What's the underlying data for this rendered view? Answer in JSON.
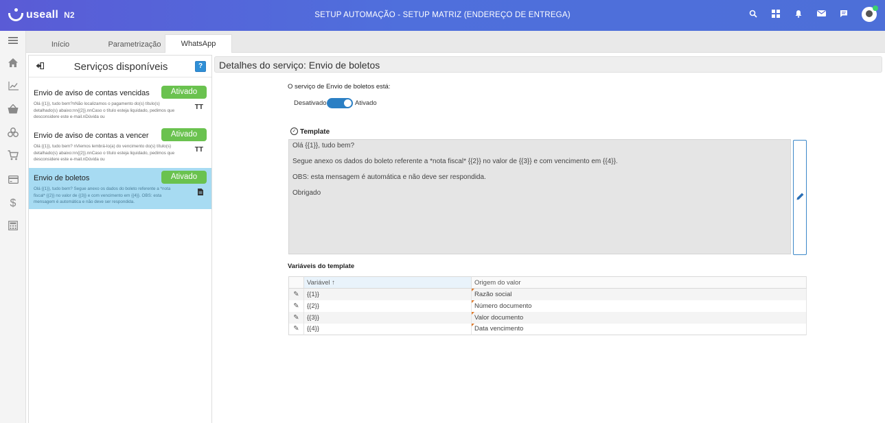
{
  "topbar": {
    "logo_text": "useall",
    "logo_sub": "N2",
    "app_title": "SETUP AUTOMAÇÃO - SETUP MATRIZ (ENDEREÇO DE ENTREGA)",
    "icons": [
      "search-icon",
      "grid-icon",
      "bell-icon",
      "mail-icon",
      "chat-icon",
      "avatar"
    ]
  },
  "rail": {
    "items": [
      "menu-icon",
      "home-icon",
      "chart-icon",
      "basket-icon",
      "boxes-icon",
      "cart-icon",
      "card-icon",
      "dollar-icon",
      "calculator-icon"
    ]
  },
  "tabs": [
    {
      "label": "Início"
    },
    {
      "label": "Parametrização"
    },
    {
      "label": "WhatsApp"
    }
  ],
  "services": {
    "title": "Serviços disponíveis",
    "help": "?",
    "items": [
      {
        "name": "Envio de aviso de contas vencidas",
        "badge": "Ativado",
        "desc": "Olá {{1}}, tudo bem?nNão localizamos o pagamento do(s) título(s) detalhado(s) abaixo:nn{{2}}.nnCaso o título esteja liquidado, pedimos que desconsidere este e-mail.nDúvida ou",
        "icon": "TT"
      },
      {
        "name": "Envio de aviso de contas a vencer",
        "badge": "Ativado",
        "desc": "Olá {{1}}, tudo bem? nViemos lembrá-lo(a) do vencimento do(s) título(s) detalhado(s) abaixo:nn{{2}}.nnCaso o título esteja liquidado, pedimos que desconsidere este e-mail.nDúvida ou",
        "icon": "TT"
      },
      {
        "name": "Envio de boletos",
        "badge": "Ativado",
        "desc": "Olá {{1}}, tudo bem? Segue anexo os dados do boleto referente a *nota fiscal* {{2}} no valor de {{3}} e com vencimento em {{4}}. OBS: esta mensagem é automática e não deve ser respondida.",
        "icon": "▮"
      }
    ]
  },
  "details": {
    "title": "Detalhes do serviço: Envio de boletos",
    "status_label": "O serviço de Envio de boletos está:",
    "toggle_off": "Desativado",
    "toggle_on": "Ativado",
    "template_label": "Template",
    "template_lines": [
      "Olá {{1}}, tudo bem?",
      "Segue anexo os dados do boleto referente a *nota fiscal* {{2}} no valor de {{3}} e com vencimento em {{4}}.",
      "OBS: esta mensagem é automática e não deve ser respondida.",
      "Obrigado"
    ],
    "vars_label": "Variáveis do template",
    "columns": [
      "Variável ↑",
      "Origem do valor"
    ],
    "rows": [
      {
        "var": "{{1}}",
        "origin": "Razão social"
      },
      {
        "var": "{{2}}",
        "origin": "Número documento"
      },
      {
        "var": "{{3}}",
        "origin": "Valor documento"
      },
      {
        "var": "{{4}}",
        "origin": "Data vencimento"
      }
    ]
  },
  "colors": {
    "topbar": "#5a5bd6",
    "accent": "#2b7fc4",
    "badge": "#6ac24f",
    "selected": "#a7dbf2"
  }
}
